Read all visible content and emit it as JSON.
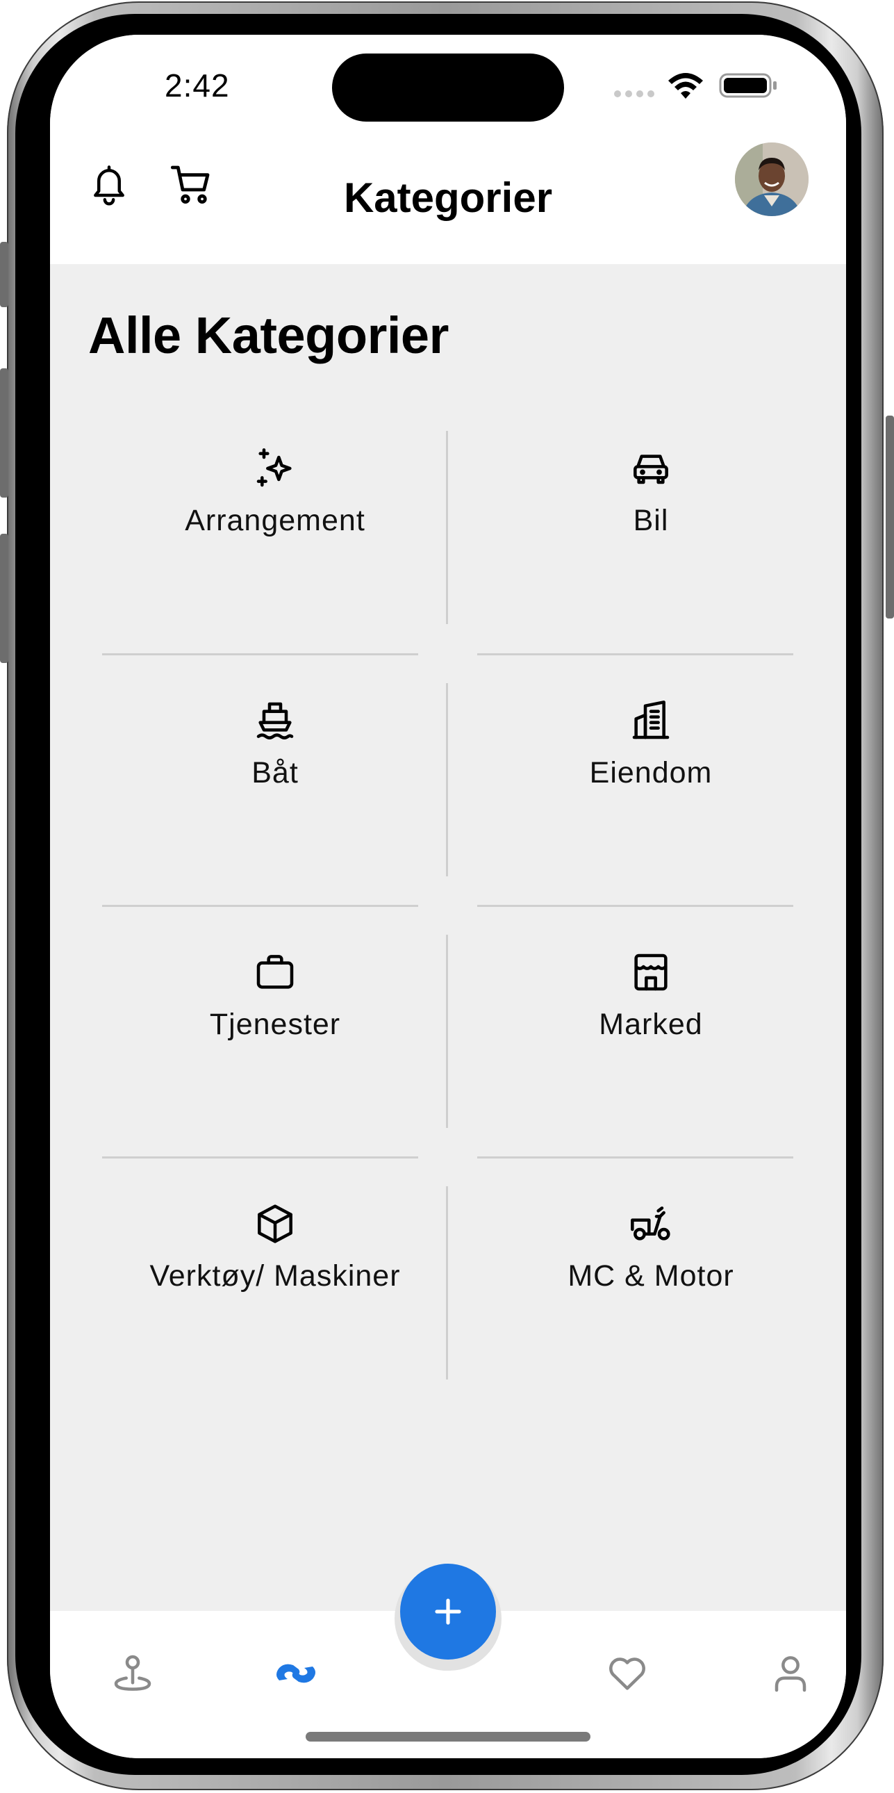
{
  "status_bar": {
    "time": "2:42"
  },
  "header": {
    "title": "Kategorier"
  },
  "main": {
    "section_title": "Alle Kategorier",
    "categories": [
      {
        "label": "Arrangement",
        "icon": "sparkles-icon"
      },
      {
        "label": "Bil",
        "icon": "car-icon"
      },
      {
        "label": "Båt",
        "icon": "ship-icon"
      },
      {
        "label": "Eiendom",
        "icon": "building-icon"
      },
      {
        "label": "Tjenester",
        "icon": "briefcase-icon"
      },
      {
        "label": "Marked",
        "icon": "store-icon"
      },
      {
        "label": "Verktøy/ Maskiner",
        "icon": "box-icon"
      },
      {
        "label": "MC & Motor",
        "icon": "scooter-icon"
      }
    ]
  },
  "tab_bar": {
    "items": [
      {
        "icon": "map-pin-icon"
      },
      {
        "icon": "app-logo-icon",
        "active": true
      },
      {
        "icon": "plus-icon"
      },
      {
        "icon": "heart-icon"
      },
      {
        "icon": "user-icon"
      }
    ]
  },
  "colors": {
    "accent": "#1f78e3",
    "background": "#efefef",
    "divider": "#cfcfcf"
  }
}
